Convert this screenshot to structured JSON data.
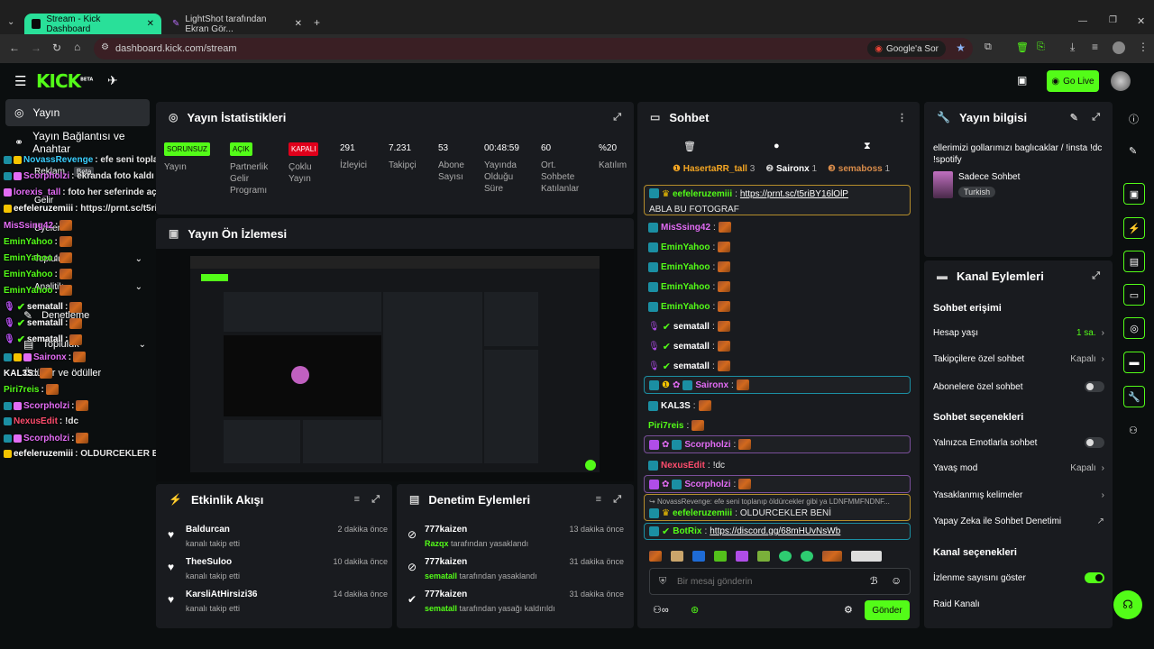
{
  "browser": {
    "tabs": [
      {
        "title": "Stream - Kick Dashboard"
      },
      {
        "title": "LightShot tarafından Ekran Gör..."
      }
    ],
    "url": "dashboard.kick.com/stream",
    "google_button": "Google'a Sor"
  },
  "header": {
    "logo": "KICK",
    "logo_beta": "BETA",
    "go_live": "Go Live"
  },
  "sidebar": {
    "items": [
      {
        "label": "Yayın"
      },
      {
        "label": "Yayın Bağlantısı ve Anahtar"
      },
      {
        "label": "Reklam"
      },
      {
        "label": "Beta"
      },
      {
        "label": "Gelir"
      },
      {
        "label": "Üyeler"
      },
      {
        "label": "Topluluk"
      },
      {
        "label": "Analitik"
      },
      {
        "label": "Denetleme"
      },
      {
        "label": "Topluluk"
      },
      {
        "label": "Ödüller ve ödüller"
      }
    ]
  },
  "overlay_chat": [
    {
      "user": "NovassRevenge",
      "color": "#3bd0ff",
      "text": ": efe seni toplanıp öldürcekler gibi ya LDNFMMFNDNFMFNNF"
    },
    {
      "user": "Scorpholzi",
      "color": "#e36cf5",
      "text": ": ekranda foto kaldı"
    },
    {
      "user": "lorexis_tall",
      "color": "#e36cf5",
      "text": ": foto her seferinde açık kalıyor ya"
    },
    {
      "user": "eefeleruzemiii",
      "color": "#ffffff",
      "text": ": https://prnt.sc/t5riBY16lOlP ABLA BU FOTOGRAF"
    },
    {
      "user": "MisSsing42",
      "color": "#e36cf5",
      "text": ":"
    },
    {
      "user": "EminYahoo",
      "color": "#53fc18",
      "text": ":"
    },
    {
      "user": "EminYahoo",
      "color": "#53fc18",
      "text": ":"
    },
    {
      "user": "EminYahoo",
      "color": "#53fc18",
      "text": ":"
    },
    {
      "user": "EminYahoo",
      "color": "#53fc18",
      "text": ":"
    },
    {
      "user": "sematall",
      "color": "#ffffff",
      "text": ":"
    },
    {
      "user": "sematall",
      "color": "#ffffff",
      "text": ":"
    },
    {
      "user": "sematall",
      "color": "#ffffff",
      "text": ":"
    },
    {
      "user": "Saironx",
      "color": "#e36cf5",
      "text": ":"
    },
    {
      "user": "KAL3S",
      "color": "#ffffff",
      "text": ":"
    },
    {
      "user": "Piri7reis",
      "color": "#53fc18",
      "text": ":"
    },
    {
      "user": "Scorpholzi",
      "color": "#e36cf5",
      "text": ":"
    },
    {
      "user": "NexusEdit",
      "color": "#ff4d6d",
      "text": ": !dc"
    },
    {
      "user": "Scorpholzi",
      "color": "#e36cf5",
      "text": ":"
    },
    {
      "user": "eefeleruzemiii",
      "color": "#ffffff",
      "text": ": OLDURCEKLER BENİ"
    }
  ],
  "stats": {
    "title": "Yayın İstatistikleri",
    "items": [
      {
        "value": "SORUNSUZ",
        "label": "Yayın",
        "tag": "green"
      },
      {
        "value": "AÇIK",
        "label": "Partnerlik Gelir Programı",
        "tag": "green"
      },
      {
        "value": "KAPALI",
        "label": "Çoklu Yayın",
        "tag": "red"
      },
      {
        "value": "291",
        "label": "İzleyici"
      },
      {
        "value": "7.231",
        "label": "Takipçi"
      },
      {
        "value": "53",
        "label": "Abone Sayısı"
      },
      {
        "value": "00:48:59",
        "label": "Yayında Olduğu Süre"
      },
      {
        "value": "60",
        "label": "Ort. Sohbete Katılanlar"
      },
      {
        "value": "%20",
        "label": "Katılım"
      }
    ]
  },
  "preview": {
    "title": "Yayın Ön İzlemesi"
  },
  "activity": {
    "title": "Etkinlik Akışı",
    "rows": [
      {
        "name": "Baldurcan",
        "desc": "kanalı takip etti",
        "time": "2 dakika önce"
      },
      {
        "name": "TheeSuloo",
        "desc": "kanalı takip etti",
        "time": "10 dakika önce"
      },
      {
        "name": "KarsliAtHirsizi36",
        "desc": "kanalı takip etti",
        "time": "14 dakika önce"
      }
    ]
  },
  "moderation": {
    "title": "Denetim Eylemleri",
    "rows": [
      {
        "name": "777kaizen",
        "actor": "Razqx",
        "desc": "tarafından yasaklandı",
        "time": "13 dakika önce"
      },
      {
        "name": "777kaizen",
        "actor": "sematall",
        "desc": "tarafından yasaklandı",
        "time": "31 dakika önce"
      },
      {
        "name": "777kaizen",
        "actor": "sematall",
        "desc": "tarafından yasağı kaldırıldı",
        "time": "31 dakika önce"
      }
    ]
  },
  "chat": {
    "title": "Sohbet",
    "top_gifters": [
      {
        "name": "HasertaRR_tall",
        "count": "3"
      },
      {
        "name": "Saironx",
        "count": "1"
      },
      {
        "name": "semaboss",
        "count": "1"
      }
    ],
    "messages": [
      {
        "user": "eefeleruzemiii",
        "color": "#53fc18",
        "link": "https://prnt.sc/t5riBY16lOlP",
        "text": "ABLA BU FOTOGRAF",
        "boxed": true
      },
      {
        "user": "MisSsing42",
        "color": "#e36cf5"
      },
      {
        "user": "EminYahoo",
        "color": "#53fc18"
      },
      {
        "user": "EminYahoo",
        "color": "#53fc18"
      },
      {
        "user": "EminYahoo",
        "color": "#53fc18"
      },
      {
        "user": "EminYahoo",
        "color": "#53fc18"
      },
      {
        "user": "sematall",
        "color": "#ffffff"
      },
      {
        "user": "sematall",
        "color": "#ffffff"
      },
      {
        "user": "sematall",
        "color": "#ffffff"
      },
      {
        "user": "Saironx",
        "color": "#e36cf5",
        "boxed": true
      },
      {
        "user": "KAL3S",
        "color": "#ffffff"
      },
      {
        "user": "Piri7reis",
        "color": "#53fc18"
      },
      {
        "user": "Scorpholzi",
        "color": "#e36cf5",
        "boxed": true
      },
      {
        "user": "NexusEdit",
        "color": "#ff4d6d",
        "text": "!dc"
      },
      {
        "user": "Scorpholzi",
        "color": "#e36cf5",
        "boxed": true
      },
      {
        "reply": "NovassRevenge: efe seni toplanıp öldürcekler gibi ya LDNFMMFNDNF...",
        "user": "eefeleruzemiii",
        "color": "#53fc18",
        "text": "OLDURCEKLER BENİ",
        "boxed": true
      },
      {
        "user": "BotRix",
        "color": "#53fc18",
        "link": "https://discord.gg/68mHUvNsWb",
        "boxed": true
      }
    ],
    "input_placeholder": "Bir mesaj gönderin",
    "send": "Gönder"
  },
  "stream_info": {
    "title": "Yayın bilgisi",
    "stream_title": "ellerimizi gollarımızı baglıcaklar / !insta !dc !spotify",
    "category": "Sadece Sohbet",
    "language": "Turkish"
  },
  "channel_actions": {
    "title": "Kanal Eylemleri",
    "chat_access": "Sohbet erişimi",
    "account_age": {
      "label": "Hesap yaşı",
      "value": "1 sa."
    },
    "followers_only": {
      "label": "Takipçilere özel sohbet",
      "value": "Kapalı"
    },
    "subscribers_only": {
      "label": "Abonelere özel sohbet"
    },
    "chat_options": "Sohbet seçenekleri",
    "emote_only": {
      "label": "Yalnızca Emotlarla sohbet"
    },
    "slow_mode": {
      "label": "Yavaş mod",
      "value": "Kapalı"
    },
    "banned_words": {
      "label": "Yasaklanmış kelimeler"
    },
    "ai_moderation": {
      "label": "Yapay Zeka ile Sohbet Denetimi"
    },
    "channel_options": "Kanal seçenekleri",
    "show_viewers": {
      "label": "İzlenme sayısını göster"
    },
    "raid": {
      "label": "Raid Kanalı"
    }
  }
}
